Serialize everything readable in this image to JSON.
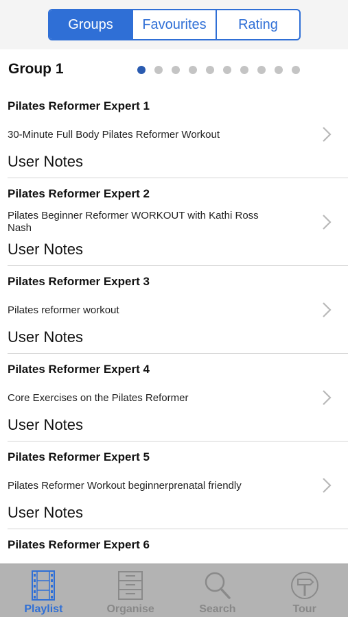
{
  "segments": {
    "items": [
      {
        "label": "Groups"
      },
      {
        "label": "Favourites"
      },
      {
        "label": "Rating"
      }
    ],
    "selected": "Groups"
  },
  "group": {
    "title": "Group 1",
    "page_count": 10,
    "current_page": 1
  },
  "rows": [
    {
      "expert": "Pilates Reformer Expert 1",
      "video": "30-Minute Full Body Pilates Reformer Workout",
      "notes": "User Notes"
    },
    {
      "expert": "Pilates Reformer Expert 2",
      "video": "Pilates Beginner Reformer WORKOUT with Kathi Ross Nash",
      "notes": "User Notes"
    },
    {
      "expert": "Pilates Reformer Expert 3",
      "video": "Pilates reformer workout",
      "notes": "User Notes"
    },
    {
      "expert": "Pilates Reformer Expert 4",
      "video": "Core Exercises on the Pilates Reformer",
      "notes": "User Notes"
    },
    {
      "expert": "Pilates Reformer Expert 5",
      "video": "Pilates Reformer Workout beginnerprenatal friendly",
      "notes": "User Notes"
    },
    {
      "expert": "Pilates Reformer Expert 6",
      "video": "",
      "notes": ""
    }
  ],
  "tabbar": {
    "items": [
      {
        "label": "Playlist",
        "icon": "film-strip-icon"
      },
      {
        "label": "Organise",
        "icon": "cabinet-icon"
      },
      {
        "label": "Search",
        "icon": "magnifier-icon"
      },
      {
        "label": "Tour",
        "icon": "signpost-icon"
      }
    ],
    "active": "Playlist"
  },
  "colors": {
    "accent": "#2f6fd6",
    "page_dot_active": "#2a5bb0",
    "page_dot_inactive": "#c4c4c4",
    "tabbar_bg": "#b3b3b3",
    "tab_inactive": "#888888"
  }
}
